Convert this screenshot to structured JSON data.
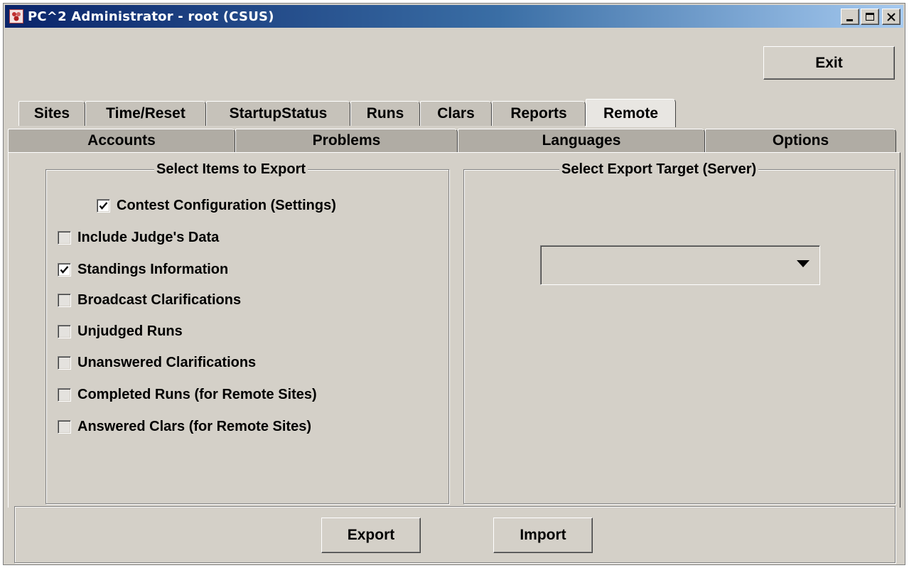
{
  "window": {
    "title": "PC^2 Administrator  -  root (CSUS)",
    "minimize_icon": "minimize-icon",
    "maximize_icon": "maximize-icon",
    "close_icon": "close-icon"
  },
  "toolbar": {
    "exit_label": "Exit"
  },
  "tabs": {
    "row1": [
      {
        "label": "Sites"
      },
      {
        "label": "Time/Reset"
      },
      {
        "label": "StartupStatus"
      },
      {
        "label": "Runs"
      },
      {
        "label": "Clars"
      },
      {
        "label": "Reports"
      },
      {
        "label": "Remote",
        "active": true
      }
    ],
    "row2": [
      {
        "label": "Accounts"
      },
      {
        "label": "Problems"
      },
      {
        "label": "Languages"
      },
      {
        "label": "Options"
      }
    ]
  },
  "export_items": {
    "title": "Select Items to Export",
    "items": [
      {
        "label": "Contest Configuration (Settings)",
        "checked": true
      },
      {
        "label": "Include Judge's Data",
        "checked": false
      },
      {
        "label": "Standings Information",
        "checked": true
      },
      {
        "label": "Broadcast Clarifications",
        "checked": false
      },
      {
        "label": "Unjudged Runs",
        "checked": false
      },
      {
        "label": "Unanswered Clarifications",
        "checked": false
      },
      {
        "label": "Completed Runs (for Remote Sites)",
        "checked": false
      },
      {
        "label": "Answered Clars (for Remote Sites)",
        "checked": false
      }
    ]
  },
  "export_target": {
    "title": "Select Export Target (Server)",
    "selected_value": ""
  },
  "actions": {
    "export_label": "Export",
    "import_label": "Import"
  },
  "colors": {
    "titlebar_start": "#0a246a",
    "titlebar_end": "#a6caf0",
    "face": "#d4d0c8"
  }
}
